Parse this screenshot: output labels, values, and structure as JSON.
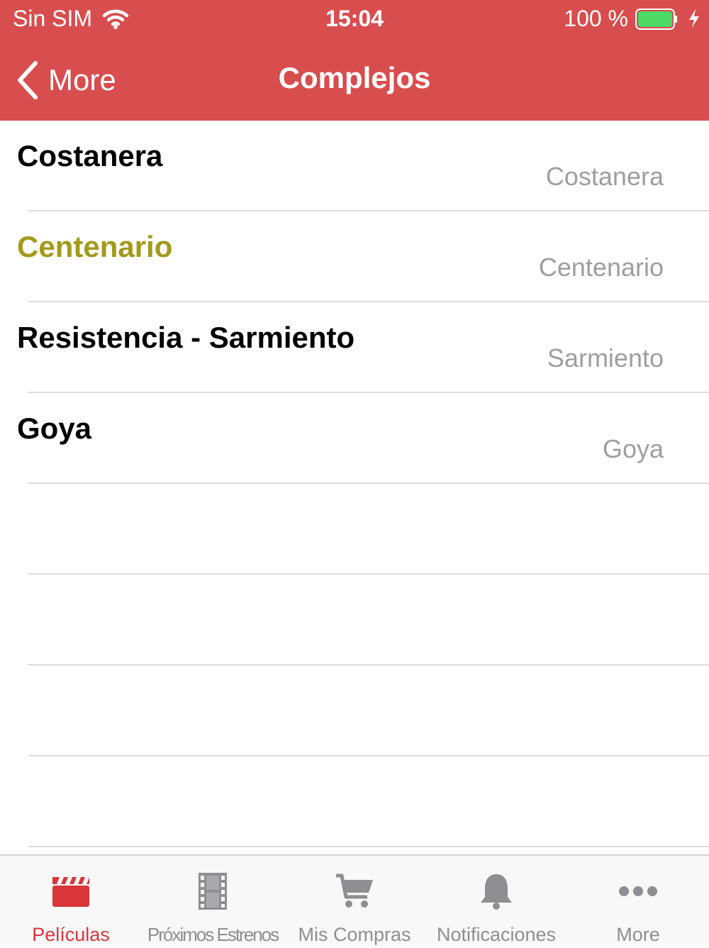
{
  "status_bar": {
    "carrier": "Sin SIM",
    "time": "15:04",
    "battery_percent": "100 %",
    "battery_level": 1.0,
    "icons": [
      "wifi-icon",
      "battery-icon",
      "charging-bolt-icon"
    ]
  },
  "nav": {
    "back_label": "More",
    "title": "Complejos"
  },
  "list": {
    "items": [
      {
        "title": "Costanera",
        "subtitle": "Costanera",
        "title_color": "#000000"
      },
      {
        "title": "Centenario",
        "subtitle": "Centenario",
        "title_color": "#a39a1c"
      },
      {
        "title": "Resistencia - Sarmiento",
        "subtitle": "Sarmiento",
        "title_color": "#000000"
      },
      {
        "title": "Goya",
        "subtitle": "Goya",
        "title_color": "#000000"
      }
    ]
  },
  "tab_bar": {
    "tabs": [
      {
        "label": "Películas",
        "icon": "clapperboard-icon",
        "active": true
      },
      {
        "label": "Próximos Estrenos",
        "icon": "film-strip-icon",
        "active": false
      },
      {
        "label": "Mis Compras",
        "icon": "cart-icon",
        "active": false
      },
      {
        "label": "Notificaciones",
        "icon": "bell-icon",
        "active": false
      },
      {
        "label": "More",
        "icon": "more-dots-icon",
        "active": false
      }
    ]
  },
  "colors": {
    "accent": "#d84d4e",
    "active_tab": "#d8363a",
    "inactive_tab": "#8e8e93",
    "subtitle": "#9e9e9e",
    "highlight_title": "#a39a1c"
  }
}
